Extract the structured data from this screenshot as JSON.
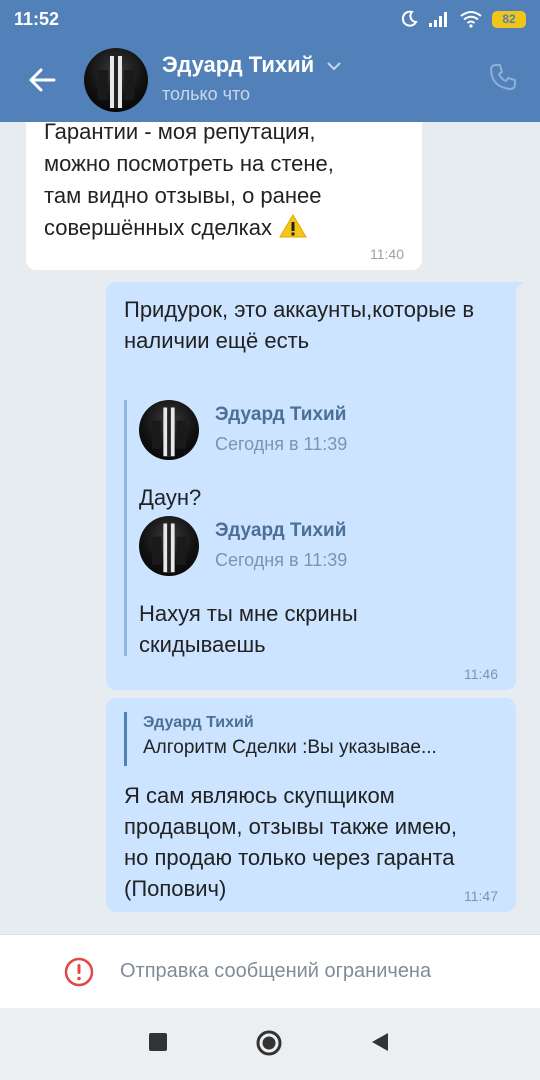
{
  "status_bar": {
    "time": "11:52",
    "battery": "82"
  },
  "header": {
    "contact_name": "Эдуард Тихий",
    "status": "только что"
  },
  "messages": {
    "incoming": {
      "text": "Гарантии - моя репутация, можно посмотреть на стене, там видно отзывы, о ранее совершённых сделках",
      "time": "11:40"
    },
    "outgoing_1": {
      "text": "Придурок, это аккаунты,которые в наличии ещё есть",
      "forwarded": [
        {
          "name": "Эдуард Тихий",
          "date": "Сегодня в 11:39",
          "text": "Даун?"
        },
        {
          "name": "Эдуард Тихий",
          "date": "Сегодня в 11:39",
          "text": "Нахуя ты мне скрины скидываешь"
        }
      ],
      "time": "11:46"
    },
    "outgoing_2": {
      "reply_name": "Эдуард Тихий",
      "reply_text": "Алгоритм Сделки :Вы указывае...",
      "text": "Я сам являюсь скупщиком продавцом, отзывы также имею, но продаю только через гаранта (Попович)",
      "time": "11:47"
    }
  },
  "restricted": {
    "label": "Отправка сообщений ограничена"
  },
  "colors": {
    "header": "#5181b8",
    "outgoing_bubble": "#cce4ff",
    "incoming_bubble": "#ffffff",
    "warning": "#f5c518",
    "error": "#e64646"
  }
}
